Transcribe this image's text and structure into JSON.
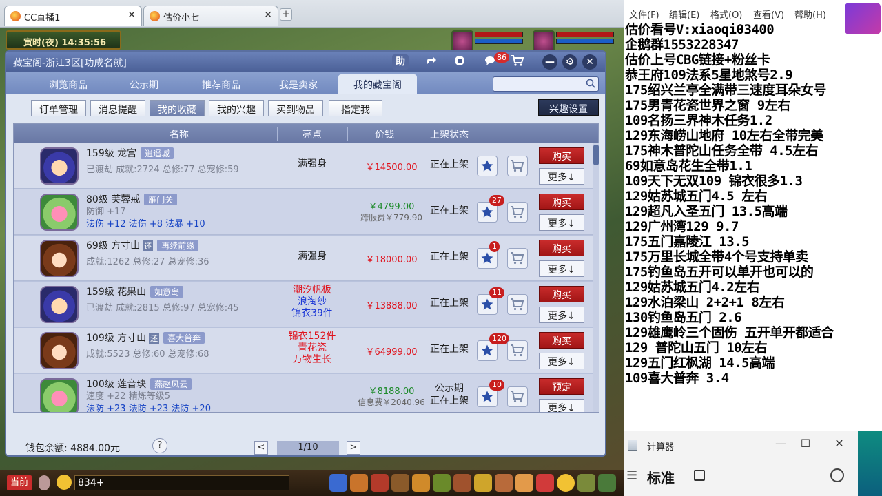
{
  "browser": {
    "tabs": [
      {
        "label": "CC直播1"
      },
      {
        "label": "估价小七"
      }
    ],
    "new_tab": "+"
  },
  "game": {
    "time": "寅时(夜) 14:35:56",
    "chat_channel": "当前",
    "chat_input_value": "834+"
  },
  "shop": {
    "title": "藏宝阁-浙江3区[功成名就]",
    "help_label": "助",
    "message_count": "86",
    "main_tabs": [
      "浏览商品",
      "公示期",
      "推荐商品",
      "我是卖家",
      "我的藏宝阁"
    ],
    "search": {
      "value": "",
      "placeholder": ""
    },
    "sub_tabs": [
      "订单管理",
      "消息提醒",
      "我的收藏",
      "我的兴趣",
      "买到物品",
      "指定我"
    ],
    "interest_settings": "兴趣设置",
    "columns": [
      "名称",
      "亮点",
      "价钱",
      "上架状态"
    ],
    "rows": [
      {
        "level_school": "159级 龙宫",
        "server": "逍遥城",
        "stats": "已渡劫 成就:2724 总修:77 总宠修:59",
        "highlight": [
          "满强身"
        ],
        "price": "￥14500.00",
        "status": "正在上架",
        "fav_count": "",
        "buy": "购买",
        "more": "更多↓"
      },
      {
        "level_school": "80级 芙蓉戒",
        "server": "雁门关",
        "stats": "防御 +17",
        "stats2": "法伤 +12 法伤 +8 法暴 +10",
        "highlight": [],
        "price": "￥4799.00",
        "fee": "跨服费￥779.90",
        "status": "正在上架",
        "fav_count": "27",
        "buy": "购买",
        "more": "更多↓"
      },
      {
        "level_school": "69级 方寸山",
        "huan": "还",
        "server": "再续前缘",
        "stats": "成就:1262 总修:27 总宠修:36",
        "highlight": [
          "满强身"
        ],
        "price": "￥18000.00",
        "status": "正在上架",
        "fav_count": "1",
        "buy": "购买",
        "more": "更多↓"
      },
      {
        "level_school": "159级 花果山",
        "server": "如意岛",
        "stats": "已渡劫 成就:2815 总修:97 总宠修:45",
        "highlight": [
          "潮汐帆板",
          "浪淘纱",
          "锦衣39件"
        ],
        "price": "￥13888.00",
        "status": "正在上架",
        "fav_count": "11",
        "buy": "购买",
        "more": "更多↓"
      },
      {
        "level_school": "109级 方寸山",
        "huan": "还",
        "server": "喜大普奔",
        "stats": "成就:5523 总修:60 总宠修:68",
        "highlight": [
          "锦衣152件",
          "青花瓷",
          "万物生长"
        ],
        "price": "￥64999.00",
        "status": "正在上架",
        "fav_count": "120",
        "buy": "购买",
        "more": "更多↓"
      },
      {
        "level_school": "100级 莲音玦",
        "server": "燕赵风云",
        "stats": "速度 +22 精炼等级5",
        "stats2": "法防 +23 法防 +23 法防 +20",
        "highlight": [],
        "price": "￥8188.00",
        "fee": "信息费￥2040.96",
        "status": "公示期",
        "status2": "正在上架",
        "fav_count": "10",
        "buy": "预定",
        "more": "更多↓"
      }
    ],
    "wallet": "钱包余额: 4884.00元",
    "help_mark": "?",
    "page": "1/10",
    "prev": "<",
    "next": ">"
  },
  "notepad": {
    "menu": [
      "文件(F)",
      "编辑(E)",
      "格式(O)",
      "查看(V)",
      "帮助(H)"
    ],
    "lines": [
      "估价看号V:xiaoqi03400",
      "企鹅群1553228347",
      "估价上号CBG链接+粉丝卡",
      "恭王府109法系5星地煞号2.9",
      "175绍兴兰亭全满带三速度耳朵女号",
      "175男青花瓷世界之窗  9左右",
      "109名扬三界神木任务1.2",
      "129东海崂山地府 10左右全带完美",
      "175神木普陀山任务全带 4.5左右",
      "69如意岛花生全带1.1",
      "109天下无双109  锦衣很多1.3",
      "129姑苏城五门4.5 左右",
      "129超凡入圣五门  13.5高端",
      "129广州湾129 9.7",
      "175五门嘉陵江 13.5",
      "175万里长城全带4个号支持单卖",
      "175钓鱼岛五开可以单开也可以的",
      "129姑苏城五门4.2左右",
      "129水泊梁山 2+2+1 8左右",
      "130钓鱼岛五门  2.6",
      "129雄鹰岭三个固伤 五开单开都适合",
      "129 普陀山五门  10左右",
      "129五门红枫湖 14.5高端",
      "109喜大普奔  3.4"
    ]
  },
  "calculator": {
    "title": "计算器",
    "mode": "标准",
    "min": "—",
    "max": "☐",
    "close": "✕",
    "menu": "☰"
  },
  "colors": {
    "price_red": "#e0141e",
    "price_green": "#1d8a2a",
    "highlight_red": "#e0141e",
    "highlight_blue": "#1a36d6",
    "fav_star": "#2b4fa8"
  }
}
